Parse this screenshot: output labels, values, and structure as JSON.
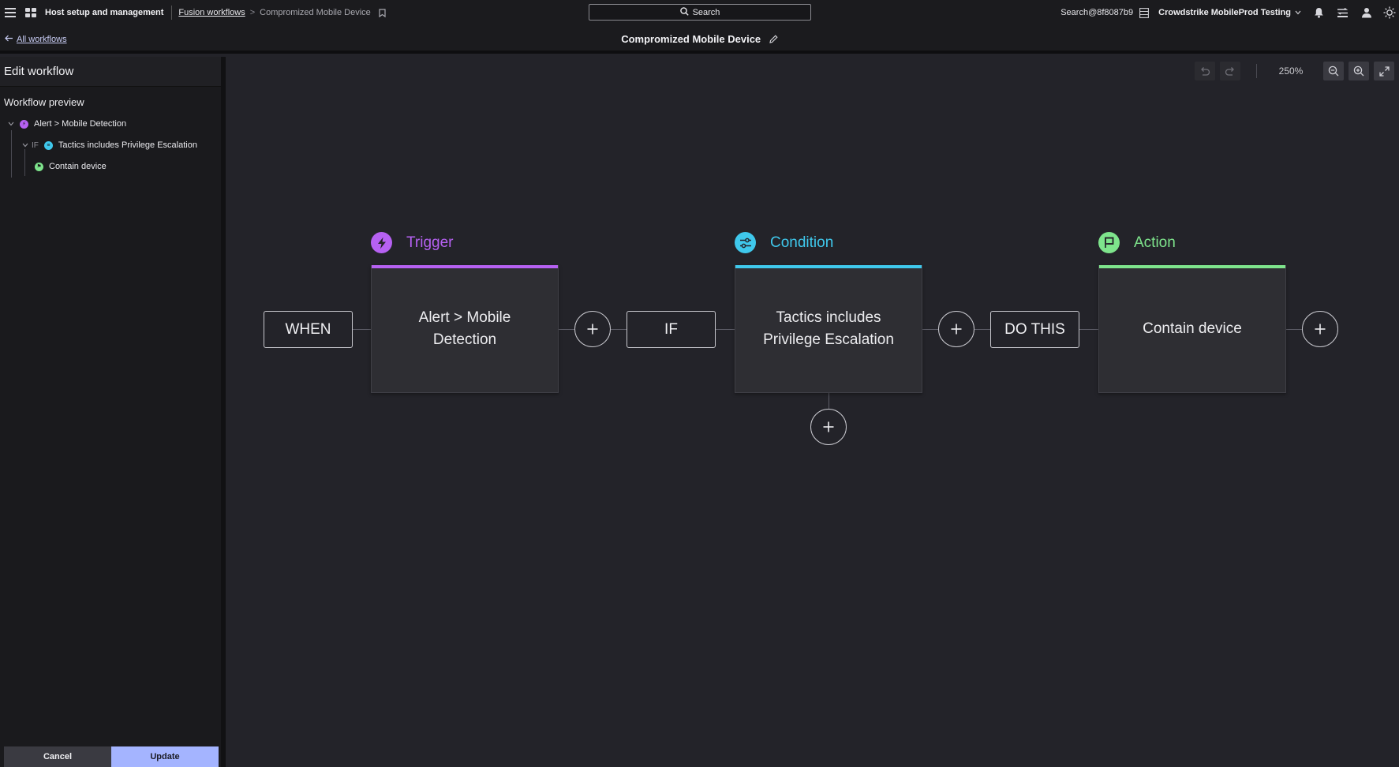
{
  "topbar": {
    "app_title": "Host setup and management",
    "breadcrumb_link": "Fusion workflows",
    "breadcrumb_sep": ">",
    "breadcrumb_current": "Compromized Mobile Device",
    "search_label": "Search",
    "user": "Search@8f8087b9",
    "tenant": "Crowdstrike MobileProd Testing"
  },
  "subbar": {
    "back_label": "All workflows",
    "workflow_title": "Compromized Mobile Device"
  },
  "sidebar": {
    "heading": "Edit workflow",
    "preview_heading": "Workflow preview",
    "tree": [
      {
        "label": "Alert > Mobile Detection",
        "kind": "trigger"
      },
      {
        "prefix": "IF",
        "label": "Tactics includes Privilege Escalation",
        "kind": "condition"
      },
      {
        "label": "Contain device",
        "kind": "action"
      }
    ],
    "cancel_label": "Cancel",
    "update_label": "Update"
  },
  "canvas": {
    "zoom": "250%",
    "when_label": "WHEN",
    "if_label": "IF",
    "do_label": "DO THIS",
    "trigger": {
      "header": "Trigger",
      "text": "Alert > Mobile Detection"
    },
    "condition": {
      "header": "Condition",
      "text": "Tactics includes Privilege Escalation"
    },
    "action": {
      "header": "Action",
      "text": "Contain device"
    }
  },
  "colors": {
    "trigger": "#b661f2",
    "condition": "#3fc8ec",
    "action": "#7ee48c",
    "update_button": "#a4b4ff"
  }
}
